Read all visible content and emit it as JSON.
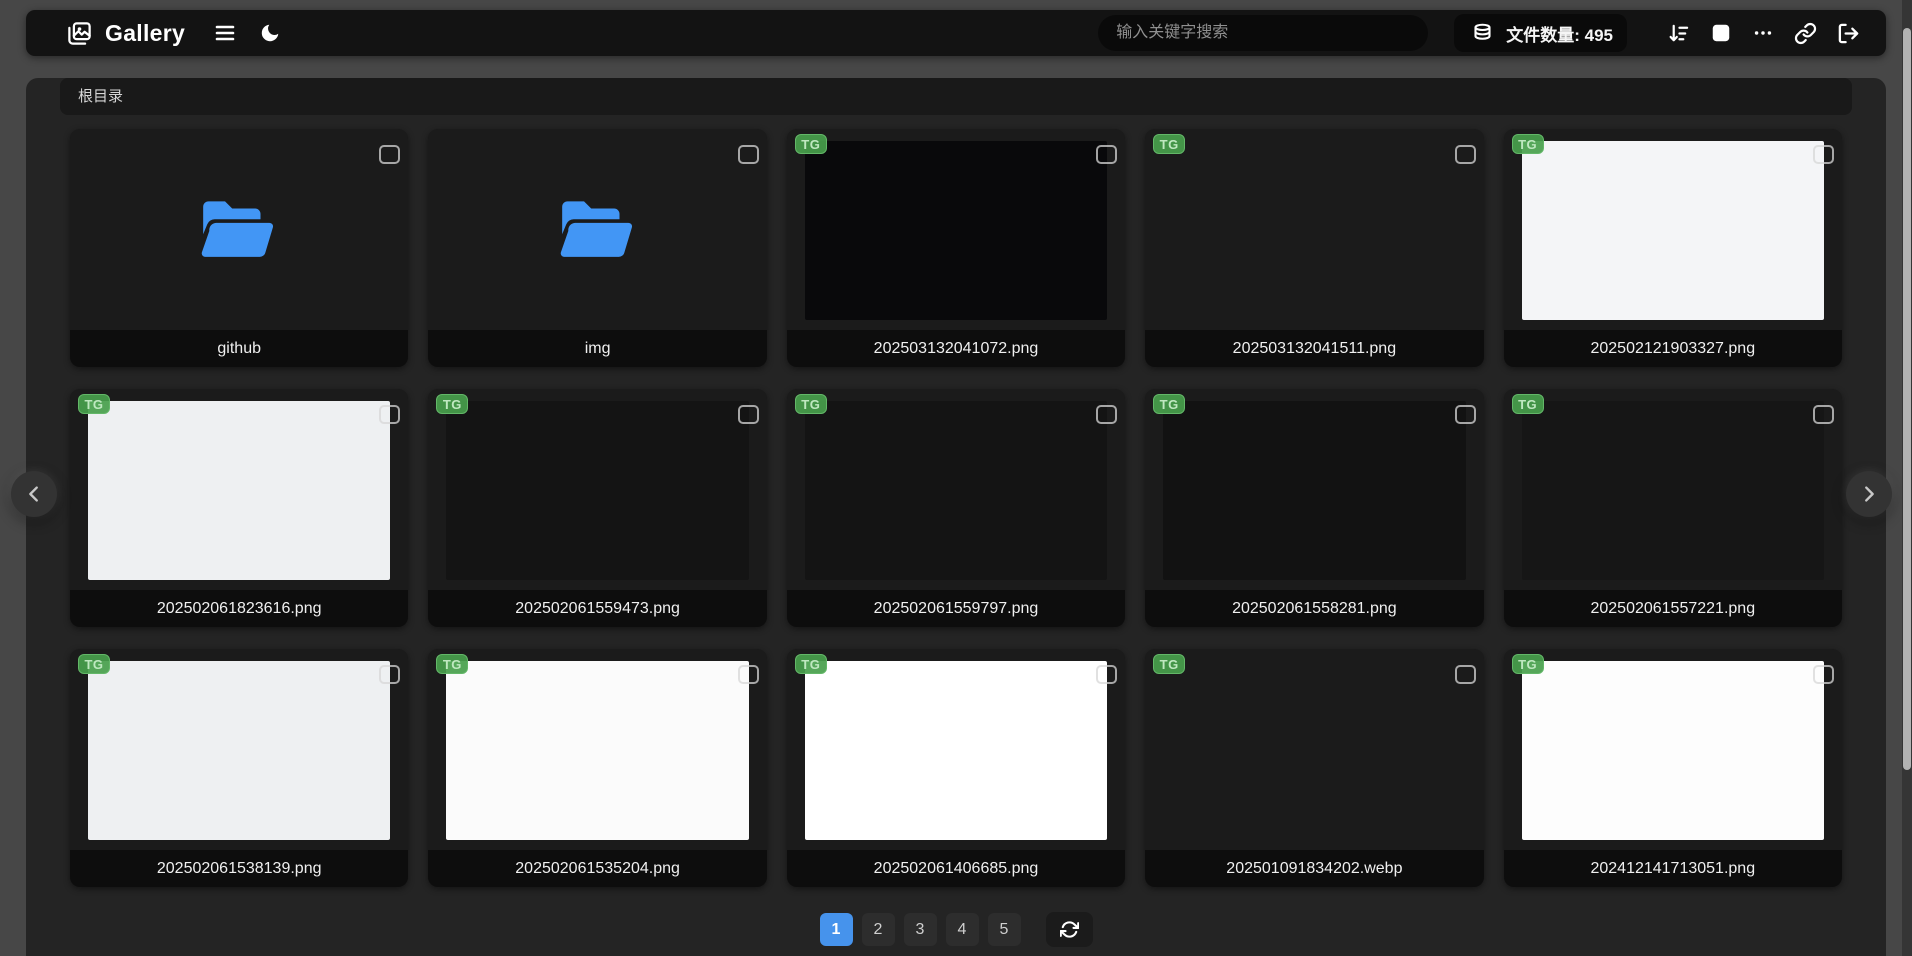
{
  "topbar": {
    "title": "Gallery",
    "search": {
      "placeholder": "输入关键字搜索",
      "value": ""
    },
    "file_count": {
      "label": "文件数量:",
      "value": "495",
      "text": "文件数量: 495"
    },
    "icons": [
      "gallery-logo-icon",
      "menu-icon",
      "moon-icon",
      "database-icon",
      "sort-descending-icon",
      "select-square-icon",
      "ellipsis-icon",
      "link-icon",
      "logout-icon"
    ]
  },
  "breadcrumb": {
    "path": "根目录"
  },
  "grid": {
    "items": [
      {
        "name": "github",
        "type": "folder",
        "badge": null,
        "art": "folder"
      },
      {
        "name": "img",
        "type": "folder",
        "badge": null,
        "art": "folder"
      },
      {
        "name": "202503132041072.png",
        "type": "image",
        "badge": "TG",
        "art": "imghub-upload"
      },
      {
        "name": "202503132041511.png",
        "type": "image",
        "badge": "TG",
        "art": "ocean-login"
      },
      {
        "name": "202502121903327.png",
        "type": "image",
        "badge": "TG",
        "art": "light-doc"
      },
      {
        "name": "202502061823616.png",
        "type": "image",
        "badge": "TG",
        "art": "light-settings"
      },
      {
        "name": "202502061559473.png",
        "type": "image",
        "badge": "TG",
        "art": "dark-toggles"
      },
      {
        "name": "202502061559797.png",
        "type": "image",
        "badge": "TG",
        "art": "dark-toggles"
      },
      {
        "name": "202502061558281.png",
        "type": "image",
        "badge": "TG",
        "art": "dark-dialog"
      },
      {
        "name": "202502061557221.png",
        "type": "image",
        "badge": "TG",
        "art": "mini-gallery"
      },
      {
        "name": "202502061538139.png",
        "type": "image",
        "badge": "TG",
        "art": "light-settings"
      },
      {
        "name": "202502061535204.png",
        "type": "image",
        "badge": "TG",
        "art": "create-app"
      },
      {
        "name": "202502061406685.png",
        "type": "image",
        "badge": "TG",
        "art": "annotated-doc"
      },
      {
        "name": "202501091834202.webp",
        "type": "image",
        "badge": "TG",
        "art": "anime-night"
      },
      {
        "name": "202412141713051.png",
        "type": "image",
        "badge": "TG",
        "art": "red-doc"
      }
    ]
  },
  "pagination": {
    "pages": [
      "1",
      "2",
      "3",
      "4",
      "5"
    ],
    "active": "1",
    "refresh_icon": "refresh-icon"
  },
  "nav_arrows": {
    "prev_icon": "chevron-left-icon",
    "next_icon": "chevron-right-icon"
  },
  "colors": {
    "accent_blue": "#4693ec",
    "badge_green": "#4caf50",
    "folder_blue": "#4296f5",
    "panel_dark": "#242424",
    "body_gray": "#474747"
  }
}
